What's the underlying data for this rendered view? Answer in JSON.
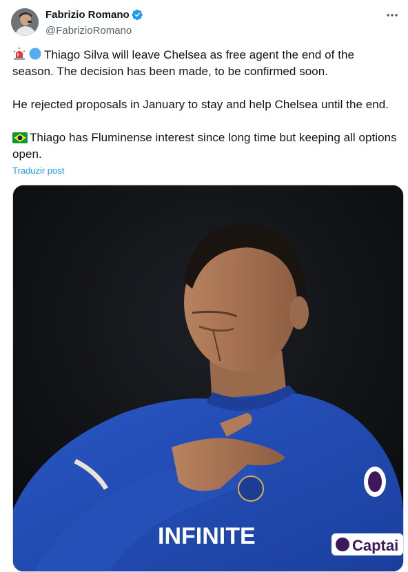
{
  "author": {
    "name": "Fabrizio Romano",
    "handle": "@FabrizioRomano"
  },
  "icons": {
    "verified": "verified-badge-icon",
    "more": "more-options-icon",
    "siren": "rotating-light-icon",
    "circle": "blue-circle-icon",
    "flag": "brazil-flag-icon"
  },
  "post": {
    "paragraphs": [
      "Thiago Silva will leave Chelsea as free agent the end of the season. The decision has been made, to be confirmed soon.",
      "He rejected proposals in January to stay and help Chelsea until the end.",
      "Thiago has Fluminense interest since long time but keeping all options open."
    ],
    "translate_label": "Traduzir post"
  },
  "media": {
    "shirt_sponsor": "INFINITE",
    "armband_text": "Captai"
  },
  "colors": {
    "accent": "#1d9bf0",
    "text": "#0f1419",
    "secondary": "#536471"
  }
}
